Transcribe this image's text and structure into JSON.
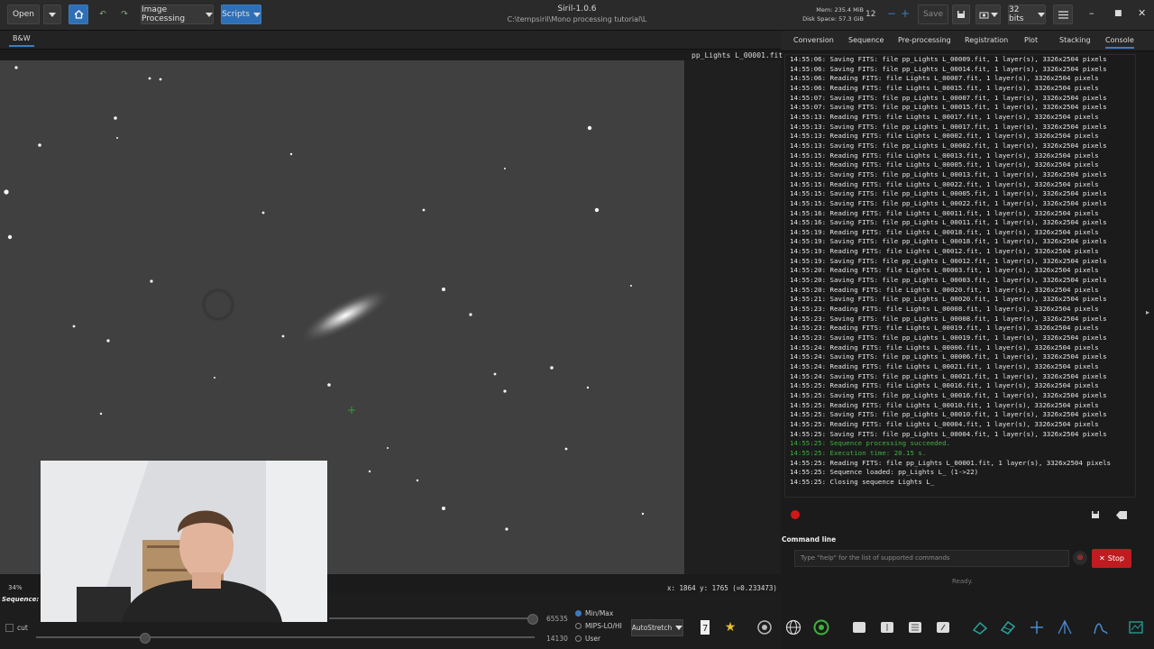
{
  "toolbar": {
    "open_label": "Open",
    "image_processing_label": "Image Processing",
    "scripts_label": "Scripts",
    "save_label": "Save",
    "bits_label": "32 bits",
    "thread_count": "12"
  },
  "window": {
    "title": "Siril-1.0.6",
    "path": "C:\\tempsiril\\Mono processing tutorial\\L",
    "mem": "Mem: 235.4 MiB",
    "disk": "Disk Space: 57.3 GiB"
  },
  "image_view": {
    "tab_label": "B&W",
    "file_name": "pp_Lights L_00001.fit",
    "zoom": "34%",
    "coords": "x: 1864 y: 1765 (=0.233473)"
  },
  "bottom": {
    "sequence_label": "Sequence: p",
    "cut_label": "cut",
    "high_value": "65535",
    "low_value": "14130",
    "modes": [
      "Min/Max",
      "MIPS-LO/HI",
      "User"
    ],
    "selected_mode": "Min/Max",
    "stretch_label": "AutoStretch"
  },
  "right_tabs": [
    "Conversion",
    "Sequence",
    "Pre-processing",
    "Registration",
    "Plot",
    "Stacking",
    "Console"
  ],
  "active_tab": "Console",
  "console_lines": [
    {
      "text": "14:55:06: Saving FITS: file pp_Lights L_00009.fit, 1 layer(s), 3326x2504 pixels",
      "color": "normal"
    },
    {
      "text": "14:55:06: Saving FITS: file pp_Lights L_00014.fit, 1 layer(s), 3326x2504 pixels",
      "color": "normal"
    },
    {
      "text": "14:55:06: Reading FITS: file Lights L_00007.fit, 1 layer(s), 3326x2504 pixels",
      "color": "normal"
    },
    {
      "text": "14:55:06: Reading FITS: file Lights L_00015.fit, 1 layer(s), 3326x2504 pixels",
      "color": "normal"
    },
    {
      "text": "14:55:07: Saving FITS: file pp_Lights L_00007.fit, 1 layer(s), 3326x2504 pixels",
      "color": "normal"
    },
    {
      "text": "14:55:07: Saving FITS: file pp_Lights L_00015.fit, 1 layer(s), 3326x2504 pixels",
      "color": "normal"
    },
    {
      "text": "14:55:13: Reading FITS: file Lights L_00017.fit, 1 layer(s), 3326x2504 pixels",
      "color": "normal"
    },
    {
      "text": "14:55:13: Saving FITS: file pp_Lights L_00017.fit, 1 layer(s), 3326x2504 pixels",
      "color": "normal"
    },
    {
      "text": "14:55:13: Reading FITS: file Lights L_00002.fit, 1 layer(s), 3326x2504 pixels",
      "color": "normal"
    },
    {
      "text": "14:55:13: Saving FITS: file pp_Lights L_00002.fit, 1 layer(s), 3326x2504 pixels",
      "color": "normal"
    },
    {
      "text": "14:55:15: Reading FITS: file Lights L_00013.fit, 1 layer(s), 3326x2504 pixels",
      "color": "normal"
    },
    {
      "text": "14:55:15: Reading FITS: file Lights L_00005.fit, 1 layer(s), 3326x2504 pixels",
      "color": "normal"
    },
    {
      "text": "14:55:15: Saving FITS: file pp_Lights L_00013.fit, 1 layer(s), 3326x2504 pixels",
      "color": "normal"
    },
    {
      "text": "14:55:15: Reading FITS: file Lights L_00022.fit, 1 layer(s), 3326x2504 pixels",
      "color": "normal"
    },
    {
      "text": "14:55:15: Saving FITS: file pp_Lights L_00005.fit, 1 layer(s), 3326x2504 pixels",
      "color": "normal"
    },
    {
      "text": "14:55:15: Saving FITS: file pp_Lights L_00022.fit, 1 layer(s), 3326x2504 pixels",
      "color": "normal"
    },
    {
      "text": "14:55:16: Reading FITS: file Lights L_00011.fit, 1 layer(s), 3326x2504 pixels",
      "color": "normal"
    },
    {
      "text": "14:55:16: Saving FITS: file pp_Lights L_00011.fit, 1 layer(s), 3326x2504 pixels",
      "color": "normal"
    },
    {
      "text": "14:55:19: Reading FITS: file Lights L_00018.fit, 1 layer(s), 3326x2504 pixels",
      "color": "normal"
    },
    {
      "text": "14:55:19: Saving FITS: file pp_Lights L_00018.fit, 1 layer(s), 3326x2504 pixels",
      "color": "normal"
    },
    {
      "text": "14:55:19: Reading FITS: file Lights L_00012.fit, 1 layer(s), 3326x2504 pixels",
      "color": "normal"
    },
    {
      "text": "14:55:19: Saving FITS: file pp_Lights L_00012.fit, 1 layer(s), 3326x2504 pixels",
      "color": "normal"
    },
    {
      "text": "14:55:20: Reading FITS: file Lights L_00003.fit, 1 layer(s), 3326x2504 pixels",
      "color": "normal"
    },
    {
      "text": "14:55:20: Saving FITS: file pp_Lights L_00003.fit, 1 layer(s), 3326x2504 pixels",
      "color": "normal"
    },
    {
      "text": "14:55:20: Reading FITS: file Lights L_00020.fit, 1 layer(s), 3326x2504 pixels",
      "color": "normal"
    },
    {
      "text": "14:55:21: Saving FITS: file pp_Lights L_00020.fit, 1 layer(s), 3326x2504 pixels",
      "color": "normal"
    },
    {
      "text": "14:55:23: Reading FITS: file Lights L_00008.fit, 1 layer(s), 3326x2504 pixels",
      "color": "normal"
    },
    {
      "text": "14:55:23: Saving FITS: file pp_Lights L_00008.fit, 1 layer(s), 3326x2504 pixels",
      "color": "normal"
    },
    {
      "text": "14:55:23: Reading FITS: file Lights L_00019.fit, 1 layer(s), 3326x2504 pixels",
      "color": "normal"
    },
    {
      "text": "14:55:23: Saving FITS: file pp_Lights L_00019.fit, 1 layer(s), 3326x2504 pixels",
      "color": "normal"
    },
    {
      "text": "14:55:24: Reading FITS: file Lights L_00006.fit, 1 layer(s), 3326x2504 pixels",
      "color": "normal"
    },
    {
      "text": "14:55:24: Saving FITS: file pp_Lights L_00006.fit, 1 layer(s), 3326x2504 pixels",
      "color": "normal"
    },
    {
      "text": "14:55:24: Reading FITS: file Lights L_00021.fit, 1 layer(s), 3326x2504 pixels",
      "color": "normal"
    },
    {
      "text": "14:55:24: Saving FITS: file pp_Lights L_00021.fit, 1 layer(s), 3326x2504 pixels",
      "color": "normal"
    },
    {
      "text": "14:55:25: Reading FITS: file Lights L_00016.fit, 1 layer(s), 3326x2504 pixels",
      "color": "normal"
    },
    {
      "text": "14:55:25: Saving FITS: file pp_Lights L_00016.fit, 1 layer(s), 3326x2504 pixels",
      "color": "normal"
    },
    {
      "text": "14:55:25: Reading FITS: file Lights L_00010.fit, 1 layer(s), 3326x2504 pixels",
      "color": "normal"
    },
    {
      "text": "14:55:25: Saving FITS: file pp_Lights L_00010.fit, 1 layer(s), 3326x2504 pixels",
      "color": "normal"
    },
    {
      "text": "14:55:25: Reading FITS: file Lights L_00004.fit, 1 layer(s), 3326x2504 pixels",
      "color": "normal"
    },
    {
      "text": "14:55:25: Saving FITS: file pp_Lights L_00004.fit, 1 layer(s), 3326x2504 pixels",
      "color": "normal"
    },
    {
      "text": "14:55:25: Sequence processing succeeded.",
      "color": "green"
    },
    {
      "text": "14:55:25: Execution time: 20.15 s.",
      "color": "green"
    },
    {
      "text": "14:55:25: Reading FITS: file pp_Lights L_00001.fit, 1 layer(s), 3326x2504 pixels",
      "color": "normal"
    },
    {
      "text": "14:55:25: Sequence loaded: pp_Lights L_ (1->22)",
      "color": "normal"
    },
    {
      "text": "14:55:25: Closing sequence Lights L_",
      "color": "normal"
    }
  ],
  "command": {
    "label": "Command line",
    "placeholder": "Type \"help\" for the list of supported commands",
    "stop_label": "Stop",
    "status": "Ready."
  },
  "colors": {
    "accent": "#2f6fb5",
    "stop": "#c01b20",
    "success_text": "#3fb23f"
  }
}
